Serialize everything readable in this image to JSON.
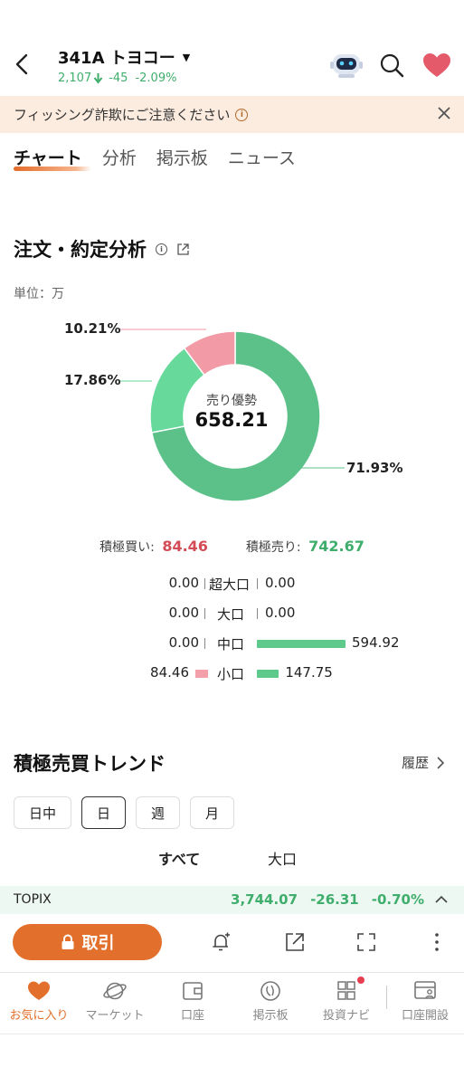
{
  "header": {
    "stock_name": "341A トヨコー",
    "price": "2,107",
    "change": "-45",
    "change_pct": "-2.09%"
  },
  "banner": {
    "text": "フィッシング詐欺にご注意ください"
  },
  "tabs": [
    "チャート",
    "分析",
    "掲示板",
    "ニュース"
  ],
  "order_analysis": {
    "title": "注文・約定分析",
    "unit": "単位：万",
    "center_label": "売り優勢",
    "center_value": "658.21",
    "slices": [
      {
        "name": "sell",
        "percent": 71.93,
        "label": "71.93%",
        "color": "#5cc189"
      },
      {
        "name": "buy",
        "percent": 17.86,
        "label": "17.86%",
        "color": "#66d99b"
      },
      {
        "name": "buy-small",
        "percent": 10.21,
        "label": "10.21%",
        "color": "#f29aa6"
      }
    ],
    "active_buy_label": "積極買い:",
    "active_buy_value": "84.46",
    "active_sell_label": "積極売り:",
    "active_sell_value": "742.67",
    "breakdown": [
      {
        "label": "超大口",
        "buy": "0.00",
        "sell": "0.00",
        "buy_num": 0,
        "sell_num": 0
      },
      {
        "label": "大口",
        "buy": "0.00",
        "sell": "0.00",
        "buy_num": 0,
        "sell_num": 0
      },
      {
        "label": "中口",
        "buy": "0.00",
        "sell": "594.92",
        "buy_num": 0,
        "sell_num": 594.92
      },
      {
        "label": "小口",
        "buy": "84.46",
        "sell": "147.75",
        "buy_num": 84.46,
        "sell_num": 147.75
      }
    ]
  },
  "trend": {
    "title": "積極売買トレンド",
    "history_label": "履歴",
    "periods": [
      "日中",
      "日",
      "週",
      "月"
    ],
    "active_period": "日",
    "size_tabs": [
      "すべて",
      "大口"
    ]
  },
  "ticker": {
    "name": "TOPIX",
    "value": "3,744.07",
    "change": "-26.31",
    "change_pct": "-0.70%"
  },
  "action_bar": {
    "trade_label": "取引"
  },
  "nav": [
    {
      "label": "お気に入り",
      "icon": "heart-icon"
    },
    {
      "label": "マーケット",
      "icon": "planet-icon"
    },
    {
      "label": "口座",
      "icon": "wallet-icon"
    },
    {
      "label": "掲示板",
      "icon": "board-icon"
    },
    {
      "label": "投資ナビ",
      "icon": "grid-icon"
    },
    {
      "label": "口座開設",
      "icon": "account-open-icon"
    }
  ],
  "colors": {
    "accent": "#e26f2b",
    "up_red": "#d34c55",
    "down_green": "#3fae6c"
  }
}
